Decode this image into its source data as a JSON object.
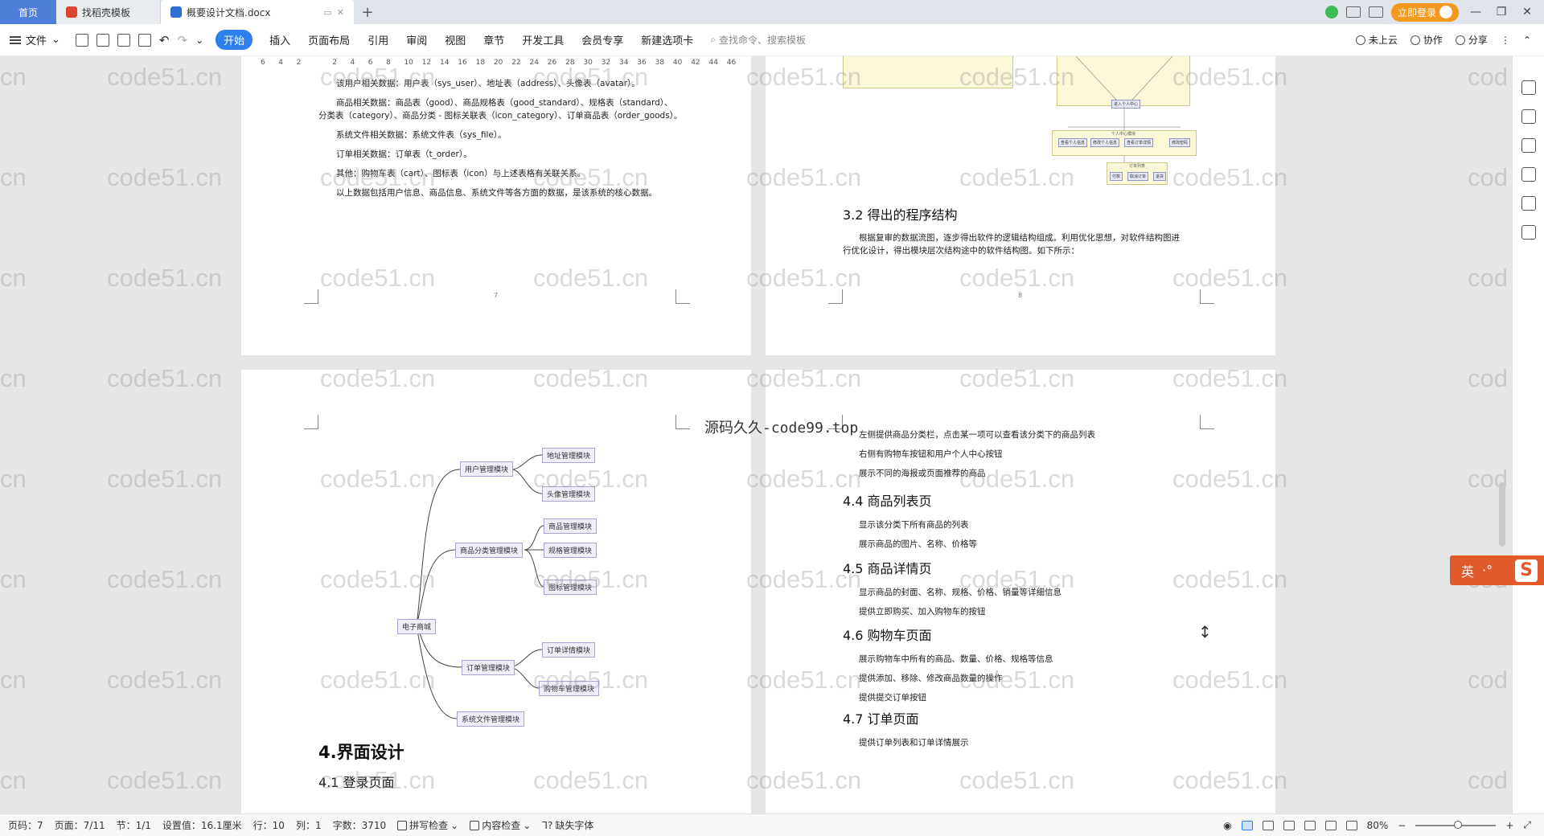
{
  "tabs": {
    "home": "首页",
    "template": "找稻壳模板",
    "document": "概要设计文档.docx",
    "new_tab": "+"
  },
  "titlebar_right": {
    "login": "立即登录"
  },
  "menubar": {
    "file": "文件",
    "items": [
      "开始",
      "插入",
      "页面布局",
      "引用",
      "审阅",
      "视图",
      "章节",
      "开发工具",
      "会员专享",
      "新建选项卡"
    ],
    "search": "查找命令、搜索模板",
    "cloud": "未上云",
    "collab": "协作",
    "share": "分享"
  },
  "ruler": [
    "6",
    "4",
    "2",
    "",
    "2",
    "4",
    "6",
    "8",
    "10",
    "12",
    "14",
    "16",
    "18",
    "20",
    "22",
    "24",
    "26",
    "28",
    "30",
    "32",
    "34",
    "36",
    "38",
    "40",
    "42",
    "44",
    "46"
  ],
  "page1": {
    "lines": [
      "该用户相关数据：用户表（sys_user）、地址表（address）、头像表（avatar）。",
      "商品相关数据：商品表（good）、商品规格表（good_standard）、规格表（standard）、",
      "分类表（category）、商品分类 - 图标关联表（icon_category）、订单商品表（order_goods）。",
      "系统文件相关数据：系统文件表（sys_file）。",
      "订单相关数据：订单表（t_order）。",
      "其他：购物车表（cart）、图标表（icon）与上述表格有关联关系。",
      "以上数据包括用户信息、商品信息、系统文件等各方面的数据，是该系统的核心数据。"
    ],
    "page_number": "7"
  },
  "page2": {
    "heading": "3.2  得出的程序结构",
    "para1": "根据复审的数据流图，逐步得出软件的逻辑结构组成。利用优化思想，对软件结构图进",
    "para2": "行优化设计，得出模块层次结构途中的软件结构图。如下所示：",
    "page_number": "8",
    "flow": {
      "top_node": "进入个人中心",
      "mid_label": "个人中心模块",
      "nodes": [
        "查看个人信息",
        "修改个人信息",
        "查看订单详情",
        "修改密码"
      ],
      "sub_label": "订单列表",
      "subnodes": [
        "付款",
        "取消订单",
        "退货"
      ]
    }
  },
  "page3": {
    "mindmap": {
      "root": "电子商城",
      "branches": [
        "用户管理模块",
        "商品分类管理模块",
        "订单管理模块",
        "系统文件管理模块"
      ],
      "leaves": [
        "地址管理模块",
        "头像管理模块",
        "商品管理模块",
        "规格管理模块",
        "图标管理模块",
        "订单详情模块",
        "购物车管理模块"
      ]
    },
    "heading1": "4.界面设计",
    "heading2": "4.1  登录页面"
  },
  "page4": {
    "lines_top": [
      "左侧提供商品分类栏，点击某一项可以查看该分类下的商品列表",
      "右侧有购物车按钮和用户个人中心按钮",
      "展示不同的海报或页面推荐的商品"
    ],
    "h44": "4.4  商品列表页",
    "lines44": [
      "显示该分类下所有商品的列表",
      "展示商品的图片、名称、价格等"
    ],
    "h45": "4.5  商品详情页",
    "lines45": [
      "显示商品的封面、名称、规格、价格、销量等详细信息",
      "提供立即购买、加入购物车的按钮"
    ],
    "h46": "4.6  购物车页面",
    "lines46": [
      "展示购物车中所有的商品、数量、价格、规格等信息",
      "提供添加、移除、修改商品数量的操作",
      "提供提交订单按钮"
    ],
    "h47": "4.7  订单页面",
    "lines47": [
      "提供订单列表和订单详情展示"
    ]
  },
  "watermark": "code51.cn",
  "watermark_edge": "cn",
  "watermark_cut": "cod",
  "overlay_text": "源码久久-code99.top",
  "ime": {
    "label": "英",
    "dots": "·°",
    "logo": "S"
  },
  "statusbar": {
    "page_code": "页码：7",
    "page": "页面：7/11",
    "section": "节：1/1",
    "setting": "设置值：16.1厘米",
    "row": "行：10",
    "col": "列：1",
    "words": "字数：3710",
    "spell": "拼写检查",
    "content_check": "内容检查",
    "missing_font": "缺失字体",
    "zoom": "80%"
  }
}
